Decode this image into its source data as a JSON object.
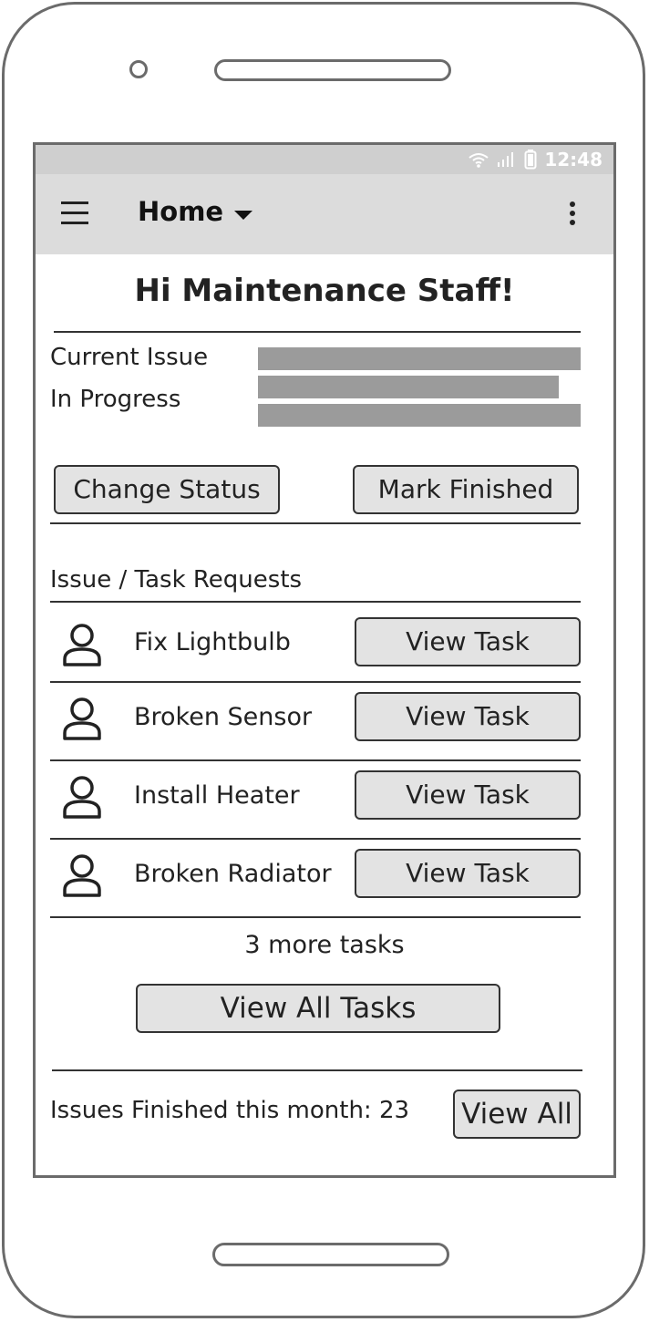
{
  "status_bar": {
    "time": "12:48",
    "icons": [
      "wifi-icon",
      "signal-icon",
      "battery-icon"
    ]
  },
  "app_bar": {
    "title": "Home",
    "menu_icon": "hamburger-menu-icon",
    "dropdown_icon": "caret-down-icon",
    "overflow_icon": "kebab-menu-icon"
  },
  "greeting": "Hi Maintenance Staff!",
  "current_issue": {
    "label_line1": "Current Issue",
    "label_line2": "In Progress",
    "change_status_label": "Change Status",
    "mark_finished_label": "Mark Finished"
  },
  "tasks": {
    "section_title": "Issue / Task Requests",
    "items": [
      {
        "name": "Fix Lightbulb",
        "button": "View Task",
        "icon": "person-icon"
      },
      {
        "name": "Broken Sensor",
        "button": "View Task",
        "icon": "person-icon"
      },
      {
        "name": "Install Heater",
        "button": "View Task",
        "icon": "person-icon"
      },
      {
        "name": "Broken Radiator",
        "button": "View Task",
        "icon": "person-icon"
      }
    ],
    "more_text": "3 more tasks",
    "view_all_label": "View All Tasks"
  },
  "footer": {
    "finished_text": "Issues Finished this month: 23",
    "view_all_label": "View All"
  }
}
